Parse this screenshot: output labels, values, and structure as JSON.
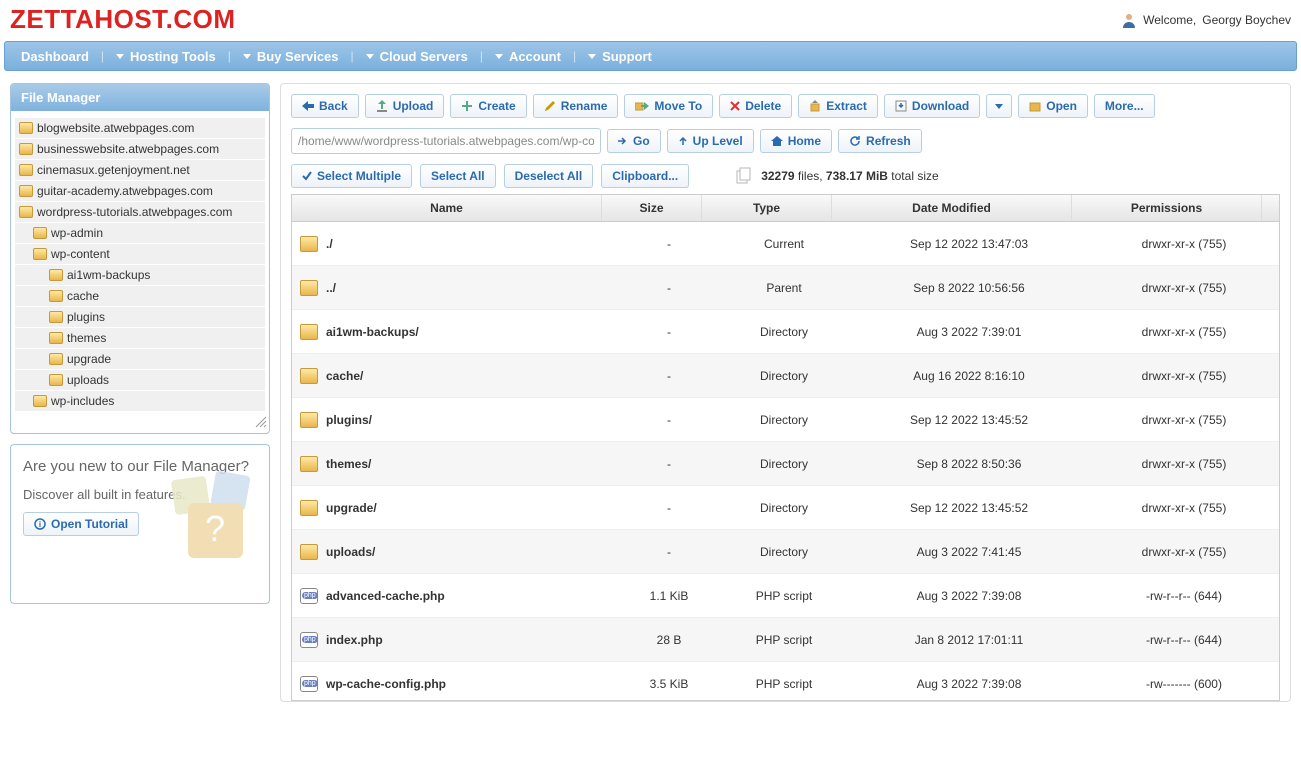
{
  "branding": {
    "logo": "ZETTAHOST.COM"
  },
  "welcome": {
    "prefix": "Welcome, ",
    "name": "Georgy Boychev"
  },
  "nav": {
    "items": [
      {
        "label": "Dashboard",
        "caret": false
      },
      {
        "label": "Hosting Tools",
        "caret": true
      },
      {
        "label": "Buy Services",
        "caret": true
      },
      {
        "label": "Cloud Servers",
        "caret": true
      },
      {
        "label": "Account",
        "caret": true
      },
      {
        "label": "Support",
        "caret": true
      }
    ]
  },
  "sidebar": {
    "title": "File Manager",
    "tree": [
      {
        "label": "blogwebsite.atwebpages.com",
        "level": 0
      },
      {
        "label": "businesswebsite.atwebpages.com",
        "level": 0
      },
      {
        "label": "cinemasux.getenjoyment.net",
        "level": 0
      },
      {
        "label": "guitar-academy.atwebpages.com",
        "level": 0
      },
      {
        "label": "wordpress-tutorials.atwebpages.com",
        "level": 0
      },
      {
        "label": "wp-admin",
        "level": 1
      },
      {
        "label": "wp-content",
        "level": 1
      },
      {
        "label": "ai1wm-backups",
        "level": 2
      },
      {
        "label": "cache",
        "level": 2
      },
      {
        "label": "plugins",
        "level": 2
      },
      {
        "label": "themes",
        "level": 2
      },
      {
        "label": "upgrade",
        "level": 2
      },
      {
        "label": "uploads",
        "level": 2
      },
      {
        "label": "wp-includes",
        "level": 1
      }
    ]
  },
  "help": {
    "q": "Are you new to our File Manager?",
    "d": "Discover all built in features.",
    "btn": "Open Tutorial"
  },
  "toolbar": {
    "back": "Back",
    "upload": "Upload",
    "create": "Create",
    "rename": "Rename",
    "moveto": "Move To",
    "delete": "Delete",
    "extract": "Extract",
    "download": "Download",
    "open": "Open",
    "more": "More..."
  },
  "pathbar": {
    "path": "/home/www/wordpress-tutorials.atwebpages.com/wp-content",
    "go": "Go",
    "uplevel": "Up Level",
    "home": "Home",
    "refresh": "Refresh"
  },
  "selection": {
    "multiple": "Select Multiple",
    "all": "Select All",
    "none": "Deselect All",
    "clip": "Clipboard..."
  },
  "stats": {
    "count": "32279",
    "files_label": " files, ",
    "size": "738.17 MiB",
    "size_label": " total size"
  },
  "columns": {
    "name": "Name",
    "size": "Size",
    "type": "Type",
    "date": "Date Modified",
    "perm": "Permissions"
  },
  "rows": [
    {
      "icon": "folder",
      "name": "./",
      "size": "-",
      "type": "Current",
      "date": "Sep 12 2022 13:47:03",
      "perm": "drwxr-xr-x (755)"
    },
    {
      "icon": "folder-up",
      "name": "../",
      "size": "-",
      "type": "Parent",
      "date": "Sep 8 2022 10:56:56",
      "perm": "drwxr-xr-x (755)"
    },
    {
      "icon": "folder",
      "name": "ai1wm-backups/",
      "size": "-",
      "type": "Directory",
      "date": "Aug 3 2022 7:39:01",
      "perm": "drwxr-xr-x (755)"
    },
    {
      "icon": "folder",
      "name": "cache/",
      "size": "-",
      "type": "Directory",
      "date": "Aug 16 2022 8:16:10",
      "perm": "drwxr-xr-x (755)"
    },
    {
      "icon": "folder",
      "name": "plugins/",
      "size": "-",
      "type": "Directory",
      "date": "Sep 12 2022 13:45:52",
      "perm": "drwxr-xr-x (755)"
    },
    {
      "icon": "folder",
      "name": "themes/",
      "size": "-",
      "type": "Directory",
      "date": "Sep 8 2022 8:50:36",
      "perm": "drwxr-xr-x (755)"
    },
    {
      "icon": "folder",
      "name": "upgrade/",
      "size": "-",
      "type": "Directory",
      "date": "Sep 12 2022 13:45:52",
      "perm": "drwxr-xr-x (755)"
    },
    {
      "icon": "folder",
      "name": "uploads/",
      "size": "-",
      "type": "Directory",
      "date": "Aug 3 2022 7:41:45",
      "perm": "drwxr-xr-x (755)"
    },
    {
      "icon": "php",
      "name": "advanced-cache.php",
      "size": "1.1 KiB",
      "type": "PHP script",
      "date": "Aug 3 2022 7:39:08",
      "perm": "-rw-r--r-- (644)"
    },
    {
      "icon": "php",
      "name": "index.php",
      "size": "28 B",
      "type": "PHP script",
      "date": "Jan 8 2012 17:01:11",
      "perm": "-rw-r--r-- (644)"
    },
    {
      "icon": "php",
      "name": "wp-cache-config.php",
      "size": "3.5 KiB",
      "type": "PHP script",
      "date": "Aug 3 2022 7:39:08",
      "perm": "-rw------- (600)"
    }
  ]
}
